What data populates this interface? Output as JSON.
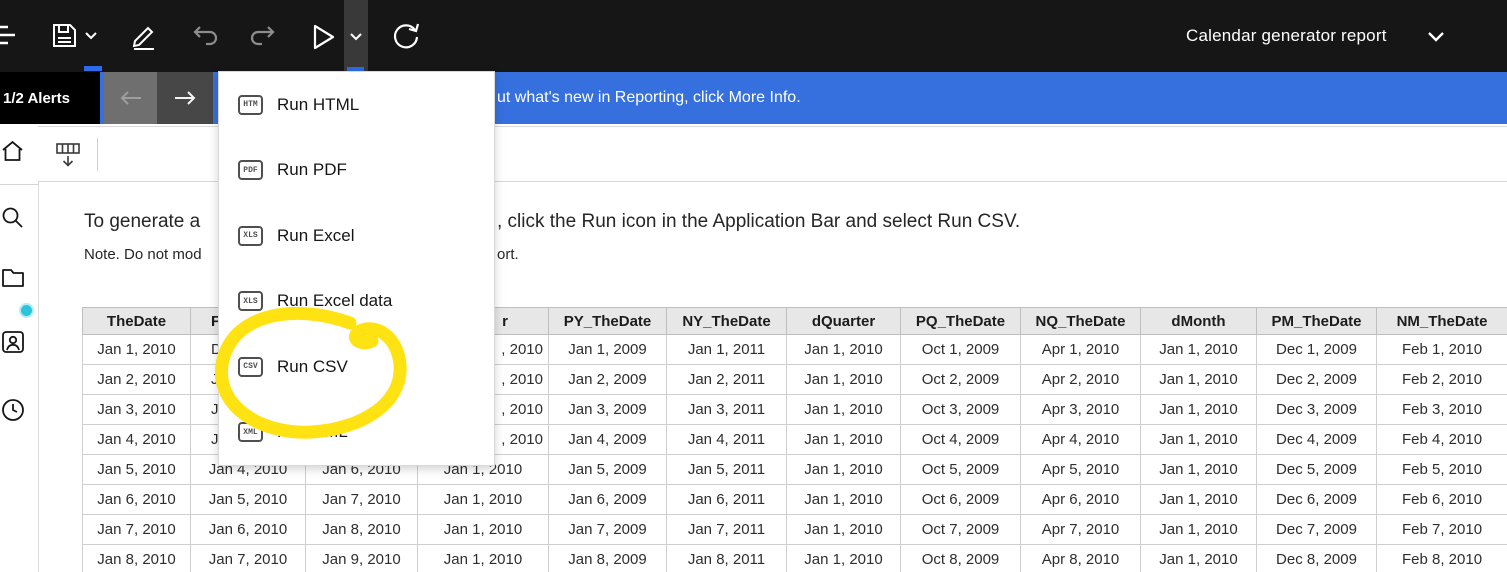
{
  "toolbar": {
    "title": "Calendar generator report",
    "icons": [
      "menu-icon",
      "save-icon",
      "save-dropdown-chevron-icon",
      "edit-icon",
      "undo-icon",
      "redo-icon",
      "run-icon",
      "run-dropdown-chevron-icon",
      "refresh-icon",
      "report-title-chevron-icon"
    ]
  },
  "alerts": {
    "label": "1/2 Alerts"
  },
  "banner": {
    "text": "ut what's new in Reporting, click More Info."
  },
  "run_menu": {
    "items": [
      {
        "badge": "HTM",
        "label": "Run HTML"
      },
      {
        "badge": "PDF",
        "label": "Run PDF"
      },
      {
        "badge": "XLS",
        "label": "Run Excel"
      },
      {
        "badge": "XLS",
        "label": "Run Excel data"
      },
      {
        "badge": "CSV",
        "label": "Run CSV",
        "annotated": true
      },
      {
        "badge": "XML",
        "label": "Run XML"
      }
    ]
  },
  "content": {
    "instruction_left": "To generate a",
    "instruction_right": ", click the Run icon in the Application Bar and select Run CSV.",
    "note_left": "Note. Do not mod",
    "note_right": "ort."
  },
  "table": {
    "headers": [
      "TheDate",
      "F",
      "",
      "r",
      "PY_TheDate",
      "NY_TheDate",
      "dQuarter",
      "PQ_TheDate",
      "NQ_TheDate",
      "dMonth",
      "PM_TheDate",
      "NM_TheDate"
    ],
    "rows": [
      [
        "Jan 1, 2010",
        "D",
        "",
        ", 2010",
        "Jan 1, 2009",
        "Jan 1, 2011",
        "Jan 1, 2010",
        "Oct 1, 2009",
        "Apr 1, 2010",
        "Jan 1, 2010",
        "Dec 1, 2009",
        "Feb 1, 2010"
      ],
      [
        "Jan 2, 2010",
        "J",
        "",
        ", 2010",
        "Jan 2, 2009",
        "Jan 2, 2011",
        "Jan 1, 2010",
        "Oct 2, 2009",
        "Apr 2, 2010",
        "Jan 1, 2010",
        "Dec 2, 2009",
        "Feb 2, 2010"
      ],
      [
        "Jan 3, 2010",
        "J",
        "",
        ", 2010",
        "Jan 3, 2009",
        "Jan 3, 2011",
        "Jan 1, 2010",
        "Oct 3, 2009",
        "Apr 3, 2010",
        "Jan 1, 2010",
        "Dec 3, 2009",
        "Feb 3, 2010"
      ],
      [
        "Jan 4, 2010",
        "J",
        "",
        ", 2010",
        "Jan 4, 2009",
        "Jan 4, 2011",
        "Jan 1, 2010",
        "Oct 4, 2009",
        "Apr 4, 2010",
        "Jan 1, 2010",
        "Dec 4, 2009",
        "Feb 4, 2010"
      ],
      [
        "Jan 5, 2010",
        "Jan 4, 2010",
        "Jan 6, 2010",
        "Jan 1, 2010",
        "Jan 5, 2009",
        "Jan 5, 2011",
        "Jan 1, 2010",
        "Oct 5, 2009",
        "Apr 5, 2010",
        "Jan 1, 2010",
        "Dec 5, 2009",
        "Feb 5, 2010"
      ],
      [
        "Jan 6, 2010",
        "Jan 5, 2010",
        "Jan 7, 2010",
        "Jan 1, 2010",
        "Jan 6, 2009",
        "Jan 6, 2011",
        "Jan 1, 2010",
        "Oct 6, 2009",
        "Apr 6, 2010",
        "Jan 1, 2010",
        "Dec 6, 2009",
        "Feb 6, 2010"
      ],
      [
        "Jan 7, 2010",
        "Jan 6, 2010",
        "Jan 8, 2010",
        "Jan 1, 2010",
        "Jan 7, 2009",
        "Jan 7, 2011",
        "Jan 1, 2010",
        "Oct 7, 2009",
        "Apr 7, 2010",
        "Jan 1, 2010",
        "Dec 7, 2009",
        "Feb 7, 2010"
      ],
      [
        "Jan 8, 2010",
        "Jan 7, 2010",
        "Jan 9, 2010",
        "Jan 1, 2010",
        "Jan 8, 2009",
        "Jan 8, 2011",
        "Jan 1, 2010",
        "Oct 8, 2009",
        "Apr 8, 2010",
        "Jan 1, 2010",
        "Dec 8, 2009",
        "Feb 8, 2010"
      ]
    ]
  },
  "colors": {
    "toolbar_bg": "#161616",
    "accent_blue": "#3670DE",
    "underline_blue": "#2D6BE8",
    "annotation_yellow": "#FFE212",
    "alert_cyan": "#2BC5DB"
  }
}
